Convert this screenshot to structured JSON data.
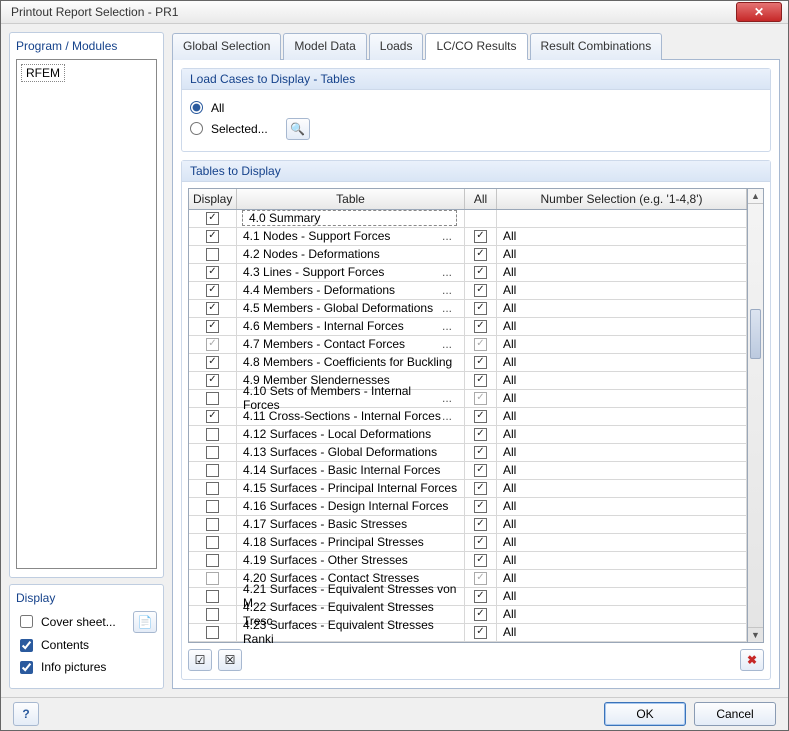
{
  "window": {
    "title": "Printout Report Selection - PR1"
  },
  "left": {
    "program_title": "Program / Modules",
    "tree_item": "RFEM",
    "display_title": "Display",
    "opts": {
      "cover_label": "Cover sheet...",
      "cover_checked": false,
      "contents_label": "Contents",
      "contents_checked": true,
      "info_label": "Info pictures",
      "info_checked": true
    }
  },
  "tabs": {
    "t1": "Global Selection",
    "t2": "Model Data",
    "t3": "Loads",
    "t4": "LC/CO Results",
    "t5": "Result Combinations"
  },
  "loadcases": {
    "title": "Load Cases to Display - Tables",
    "all": "All",
    "selected": "Selected..."
  },
  "tables_section": {
    "title": "Tables to Display",
    "hdr_display": "Display",
    "hdr_table": "Table",
    "hdr_all": "All",
    "hdr_sel": "Number Selection (e.g. '1-4,8')",
    "rows": [
      {
        "d": true,
        "g": false,
        "name": "4.0 Summary",
        "el": false,
        "a": null,
        "s": ""
      },
      {
        "d": true,
        "g": false,
        "name": "4.1 Nodes - Support Forces",
        "el": true,
        "a": true,
        "s": "All"
      },
      {
        "d": false,
        "g": false,
        "name": "4.2 Nodes - Deformations",
        "el": false,
        "a": true,
        "s": "All"
      },
      {
        "d": true,
        "g": false,
        "name": "4.3 Lines - Support Forces",
        "el": true,
        "a": true,
        "s": "All"
      },
      {
        "d": true,
        "g": false,
        "name": "4.4 Members - Deformations",
        "el": true,
        "a": true,
        "s": "All"
      },
      {
        "d": true,
        "g": false,
        "name": "4.5 Members - Global Deformations",
        "el": true,
        "a": true,
        "s": "All"
      },
      {
        "d": true,
        "g": false,
        "name": "4.6 Members - Internal Forces",
        "el": true,
        "a": true,
        "s": "All"
      },
      {
        "d": true,
        "g": true,
        "name": "4.7 Members - Contact Forces",
        "el": true,
        "a": "gray",
        "s": "All"
      },
      {
        "d": true,
        "g": false,
        "name": "4.8 Members - Coefficients for Buckling",
        "el": false,
        "a": true,
        "s": "All"
      },
      {
        "d": true,
        "g": false,
        "name": "4.9 Member Slendernesses",
        "el": false,
        "a": true,
        "s": "All"
      },
      {
        "d": false,
        "g": false,
        "name": "4.10 Sets of Members - Internal Forces",
        "el": true,
        "a": "gray",
        "s": "All"
      },
      {
        "d": true,
        "g": false,
        "name": "4.11 Cross-Sections - Internal Forces",
        "el": true,
        "a": true,
        "s": "All"
      },
      {
        "d": false,
        "g": false,
        "name": "4.12 Surfaces - Local Deformations",
        "el": false,
        "a": true,
        "s": "All"
      },
      {
        "d": false,
        "g": false,
        "name": "4.13 Surfaces - Global Deformations",
        "el": false,
        "a": true,
        "s": "All"
      },
      {
        "d": false,
        "g": false,
        "name": "4.14 Surfaces - Basic Internal Forces",
        "el": false,
        "a": true,
        "s": "All"
      },
      {
        "d": false,
        "g": false,
        "name": "4.15 Surfaces - Principal Internal Forces",
        "el": false,
        "a": true,
        "s": "All"
      },
      {
        "d": false,
        "g": false,
        "name": "4.16 Surfaces - Design Internal Forces",
        "el": false,
        "a": true,
        "s": "All"
      },
      {
        "d": false,
        "g": false,
        "name": "4.17 Surfaces - Basic Stresses",
        "el": false,
        "a": true,
        "s": "All"
      },
      {
        "d": false,
        "g": false,
        "name": "4.18 Surfaces - Principal Stresses",
        "el": false,
        "a": true,
        "s": "All"
      },
      {
        "d": false,
        "g": false,
        "name": "4.19 Surfaces - Other Stresses",
        "el": false,
        "a": true,
        "s": "All"
      },
      {
        "d": false,
        "g": true,
        "name": "4.20 Surfaces - Contact Stresses",
        "el": false,
        "a": "gray",
        "s": "All"
      },
      {
        "d": false,
        "g": false,
        "name": "4.21 Surfaces - Equivalent Stresses von M",
        "el": false,
        "a": true,
        "s": "All"
      },
      {
        "d": false,
        "g": false,
        "name": "4.22 Surfaces - Equivalent Stresses Tresc",
        "el": false,
        "a": true,
        "s": "All"
      },
      {
        "d": false,
        "g": false,
        "name": "4.23 Surfaces - Equivalent Stresses Ranki",
        "el": false,
        "a": true,
        "s": "All"
      }
    ]
  },
  "footer": {
    "ok": "OK",
    "cancel": "Cancel"
  }
}
